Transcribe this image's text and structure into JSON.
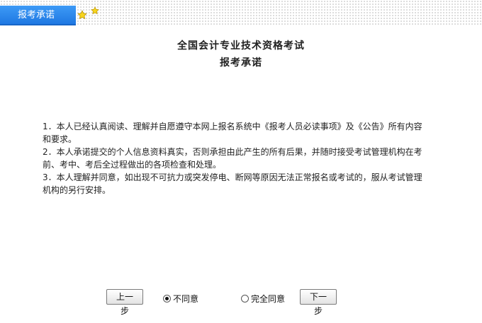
{
  "tabbar": {
    "tab_label": "报考承诺"
  },
  "page": {
    "title": "全国会计专业技术资格考试",
    "subtitle": "报考承诺"
  },
  "terms": [
    "1．本人已经认真阅读、理解并自愿遵守本网上报名系统中《报考人员必读事项》及《公告》所有内容和要求。",
    "2．本人承诺提交的个人信息资料真实，否则承担由此产生的所有后果，并随时接受考试管理机构在考前、考中、考后全过程做出的各项检查和处理。",
    "3．本人理解并同意，如出现不可抗力或突发停电、断网等原因无法正常报名或考试的，服从考试管理机构的另行安排。"
  ],
  "actions": {
    "prev_label": "上一步",
    "next_label": "下一步",
    "disagree_label": "不同意",
    "agree_label": "完全同意",
    "selected": "disagree"
  },
  "colors": {
    "tab_bg": "#2a86ee",
    "star_fill": "#f7d51e"
  }
}
